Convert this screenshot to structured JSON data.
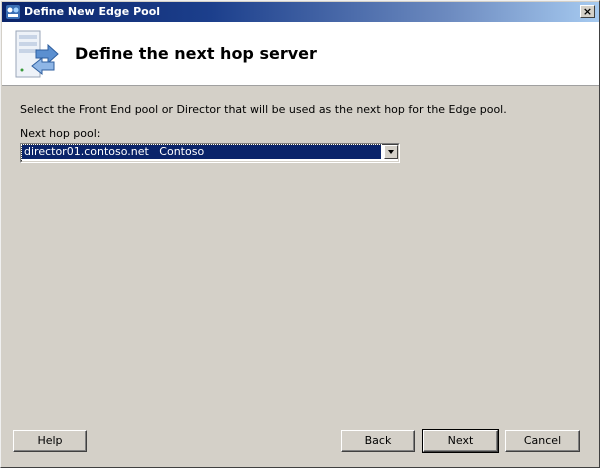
{
  "window": {
    "title": "Define New Edge Pool",
    "close_label": "×"
  },
  "header": {
    "title": "Define the next hop server",
    "icon": "server-arrow-icon"
  },
  "main": {
    "instruction": "Select the Front End pool or Director that will be used as the next hop for the Edge pool.",
    "pool_label": "Next hop pool:",
    "pool_value": "director01.contoso.net   Contoso"
  },
  "buttons": {
    "help": "Help",
    "back": "Back",
    "next": "Next",
    "cancel": "Cancel"
  },
  "colors": {
    "titlebar_start": "#0a246a",
    "titlebar_end": "#a6caf0",
    "selection": "#0a246a",
    "face": "#d4d0c8"
  }
}
